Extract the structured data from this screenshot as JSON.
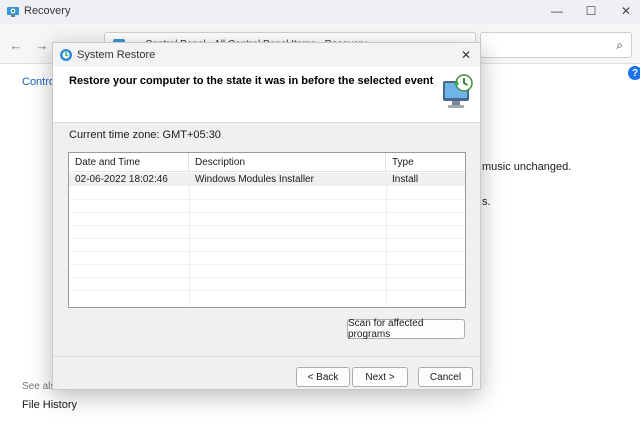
{
  "window": {
    "title": "Recovery",
    "controls": {
      "minimize": "—",
      "maximize": "☐",
      "close": "✕"
    }
  },
  "nav": {
    "back_icon": "←",
    "forward_icon": "→",
    "up_icon": "↑",
    "breadcrumb": "›  Control Panel  ›  All Control Panel Items  ›  Recovery",
    "refresh_icon": "↻",
    "search_icon": "⌕"
  },
  "background": {
    "control_link": "Control",
    "music_text": "music unchanged.",
    "dot_text": "s.",
    "see_also": "See also",
    "file_history": "File History",
    "help_icon": "?"
  },
  "dialog": {
    "title": "System Restore",
    "close_icon": "✕",
    "heading": "Restore your computer to the state it was in before the selected event",
    "time_zone": "Current time zone: GMT+05:30",
    "table": {
      "headers": [
        "Date and Time",
        "Description",
        "Type"
      ],
      "sort_caret": "ˇ",
      "rows": [
        {
          "date": "02-06-2022 18:02:46",
          "description": "Windows Modules Installer",
          "type": "Install"
        }
      ]
    },
    "scan_button": "Scan for affected programs",
    "back_button": "< Back",
    "next_button": "Next >",
    "cancel_button": "Cancel"
  },
  "colors": {
    "accent": "#1a73e8",
    "link": "#1a5fb4",
    "dialog_bg": "#f0f0f0"
  },
  "icons": {
    "app": "recovery-icon",
    "dialog": "system-restore-icon",
    "header": "restore-monitor-icon"
  }
}
